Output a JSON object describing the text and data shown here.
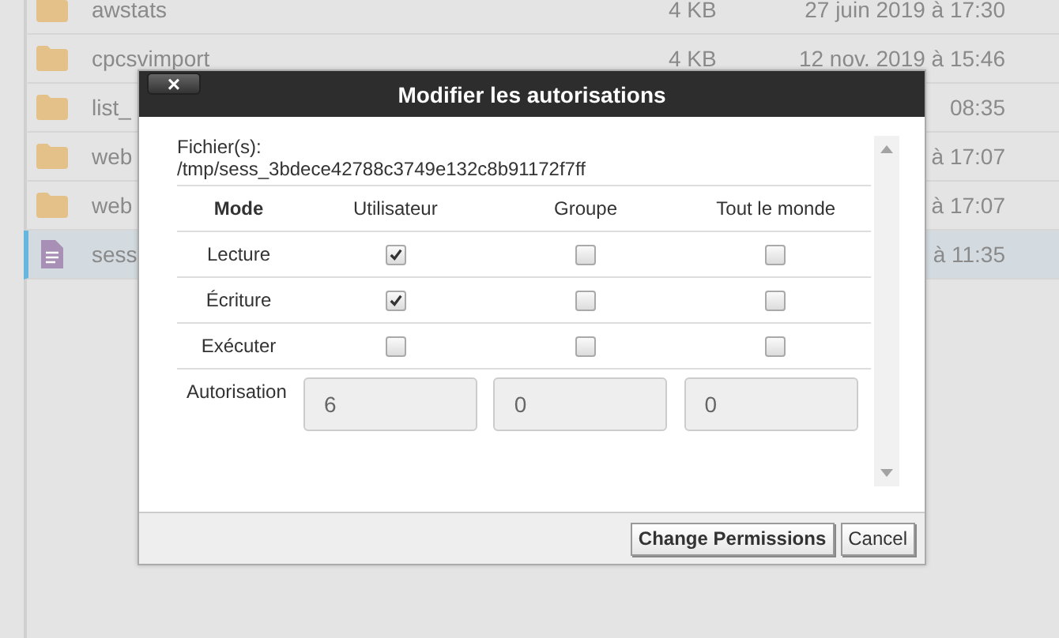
{
  "file_list": {
    "rows": [
      {
        "kind": "folder",
        "name": "awstats",
        "size": "4 KB",
        "modified": "27 juin 2019 à 17:30",
        "selected": false
      },
      {
        "kind": "folder",
        "name": "cpcsvimport",
        "size": "4 KB",
        "modified": "12 nov. 2019 à 15:46",
        "selected": false
      },
      {
        "kind": "folder",
        "name": "list_",
        "modified": "08:35",
        "selected": false
      },
      {
        "kind": "folder",
        "name": "web",
        "modified": "à 17:07",
        "selected": false
      },
      {
        "kind": "folder",
        "name": "web",
        "modified": "à 17:07",
        "selected": false
      },
      {
        "kind": "file",
        "name": "sess",
        "modified": "à 11:35",
        "selected": true
      }
    ]
  },
  "dialog": {
    "title": "Modifier les autorisations",
    "close": "×",
    "files_label": "Fichier(s):",
    "path": "/tmp/sess_3bdece42788c3749e132c8b91172f7ff",
    "columns": [
      "Mode",
      "Utilisateur",
      "Groupe",
      "Tout le monde"
    ],
    "rows": [
      {
        "label": "Lecture",
        "checks": [
          {
            "checked": true
          },
          {
            "checked": false
          },
          {
            "checked": false
          }
        ]
      },
      {
        "label": "Écriture",
        "checks": [
          {
            "checked": true
          },
          {
            "checked": false
          },
          {
            "checked": false
          }
        ]
      },
      {
        "label": "Exécuter",
        "checks": [
          {
            "checked": false
          },
          {
            "checked": false
          },
          {
            "checked": false
          }
        ]
      }
    ],
    "permission_label": "Autorisation",
    "permission_values": [
      "6",
      "0",
      "0"
    ],
    "buttons": [
      {
        "label": "Change Permissions",
        "primary": true
      },
      {
        "label": "Cancel",
        "primary": false
      }
    ]
  }
}
